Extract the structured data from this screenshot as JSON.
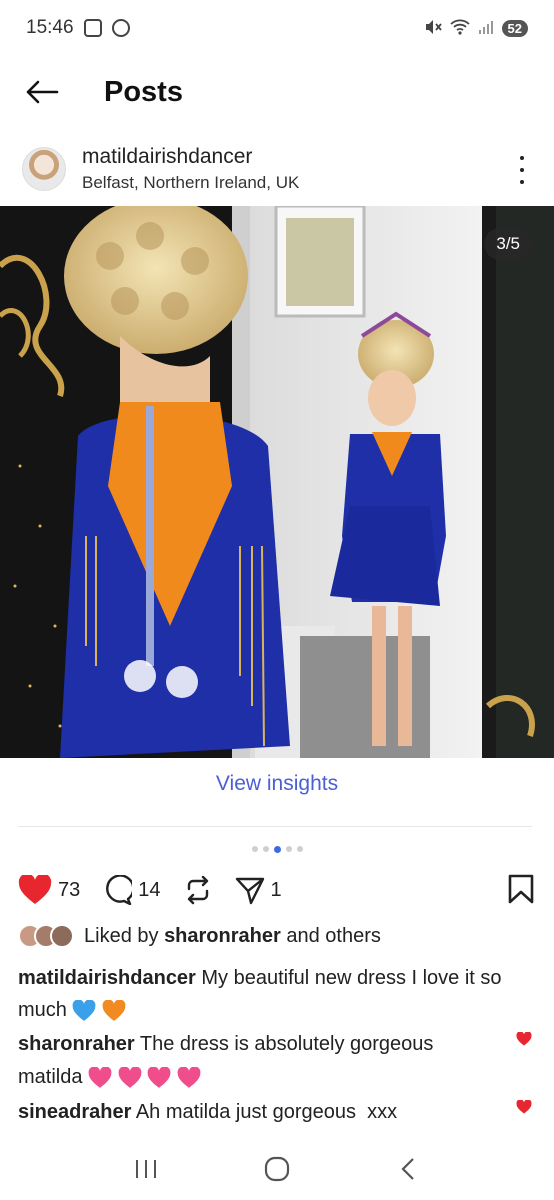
{
  "status_bar": {
    "time": "15:46",
    "battery": "52"
  },
  "header": {
    "title": "Posts"
  },
  "post": {
    "author": "matildairishdancer",
    "location": "Belfast, Northern Ireland, UK",
    "image_counter": "3/5",
    "insights_label": "View insights",
    "likes_count": "73",
    "comments_count": "14",
    "shares_count": "1",
    "liked_by_prefix": "Liked by ",
    "liked_by_user": "sharonraher",
    "liked_by_suffix": " and others",
    "caption": {
      "user": "matildairishdancer",
      "text": " My beautiful  new dress I love it so much "
    },
    "comments": [
      {
        "user": "sharonraher",
        "text": " The dress is absolutely gorgeous matilda "
      },
      {
        "user": "sineadraher",
        "text": " Ah matilda just gorgeous  xxx"
      }
    ]
  },
  "colors": {
    "accent": "#4a5fd6",
    "heart": "#e8262f",
    "dress": "#1f2fa8",
    "bodice": "#f08a1c"
  }
}
